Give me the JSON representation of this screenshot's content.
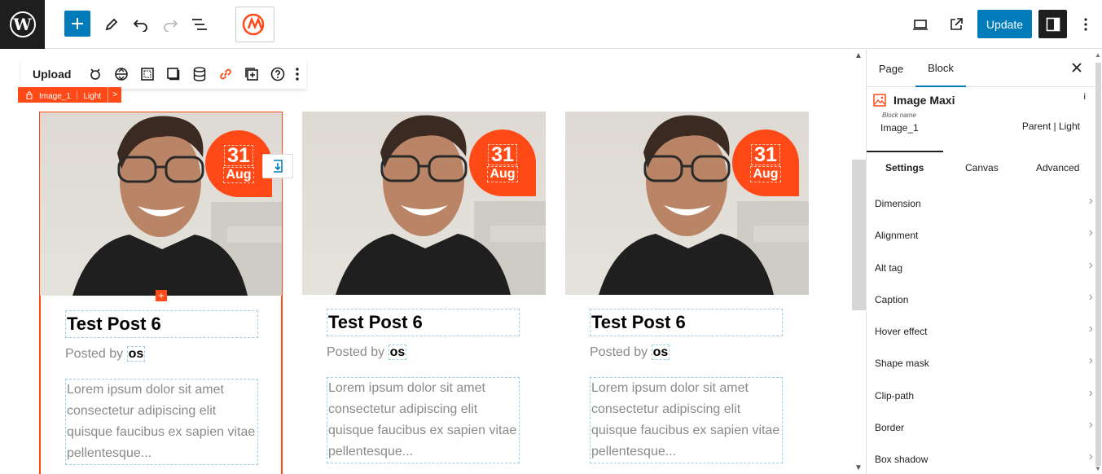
{
  "topbar": {
    "add_icon": "plus-icon",
    "tools": [
      "pencil-icon",
      "undo-icon",
      "redo-icon",
      "list-view-icon"
    ],
    "update_label": "Update"
  },
  "block_toolbar": {
    "upload_label": "Upload",
    "icons": [
      "animation-icon",
      "align-icon",
      "frame-icon",
      "shadow-icon",
      "database-icon",
      "link-icon",
      "add-block-icon",
      "help-icon",
      "more-icon"
    ]
  },
  "breadcrumb": {
    "label": "Image_1 ｜ Light",
    "arrow": ">"
  },
  "cards": [
    {
      "day": "31",
      "month": "Aug",
      "title": "Test Post 6",
      "posted_by": "Posted by",
      "author": "os",
      "excerpt": "Lorem ipsum dolor sit amet consectetur adipiscing elit quisque faucibus ex sapien vitae pellentesque..."
    },
    {
      "day": "31",
      "month": "Aug",
      "title": "Test Post 6",
      "posted_by": "Posted by",
      "author": "os",
      "excerpt": "Lorem ipsum dolor sit amet consectetur adipiscing elit quisque faucibus ex sapien vitae pellentesque..."
    },
    {
      "day": "31",
      "month": "Aug",
      "title": "Test Post 6",
      "posted_by": "Posted by",
      "author": "os",
      "excerpt": "Lorem ipsum dolor sit amet consectetur adipiscing elit quisque faucibus ex sapien vitae pellentesque..."
    }
  ],
  "sidebar": {
    "tabs": [
      "Page",
      "Block"
    ],
    "block_title": "Image Maxi",
    "info": "i",
    "block_name_label": "Block name",
    "block_name": "Image_1",
    "parent_label": "Parent | Light",
    "sub_tabs": [
      "Settings",
      "Canvas",
      "Advanced"
    ],
    "settings": [
      "Dimension",
      "Alignment",
      "Alt tag",
      "Caption",
      "Hover effect",
      "Shape mask",
      "Clip-path",
      "Border",
      "Box shadow"
    ]
  },
  "colors": {
    "accent": "#ff4a17",
    "primary": "#007cba",
    "dark": "#1e1e1e"
  }
}
